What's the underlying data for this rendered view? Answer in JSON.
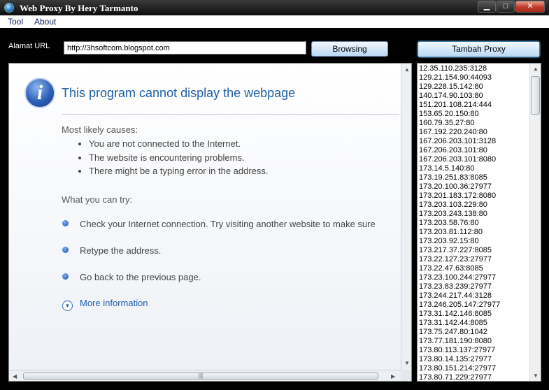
{
  "window": {
    "title": "Web Proxy By Hery Tarmanto",
    "min_glyph": "▁",
    "max_glyph": "□",
    "close_glyph": "✕"
  },
  "menu": {
    "items": [
      "Tool",
      "About"
    ]
  },
  "url_bar": {
    "label": "Alamat URL",
    "value": "http://3hsoftcom.blogspot.com"
  },
  "buttons": {
    "browse": "Browsing",
    "add_proxy": "Tambah Proxy"
  },
  "error_page": {
    "icon_glyph": "i",
    "title": "This program cannot display the webpage",
    "causes_heading": "Most likely causes:",
    "causes": [
      "You are not connected to the Internet.",
      "The website is encountering problems.",
      "There might be a typing error in the address."
    ],
    "try_heading": "What you can try:",
    "try_items": [
      "Check your Internet connection. Try visiting another website to make sure",
      "Retype the address.",
      "Go back to the previous page."
    ],
    "more_info": "More information",
    "more_glyph": "▾"
  },
  "proxies": [
    "12.35.110.235:3128",
    "129.21.154.90:44093",
    "129.228.15.142:80",
    "140.174.90.103:80",
    "151.201.108.214:444",
    "153.65.20.150:80",
    "160.79.35.27:80",
    "167.192.220.240:80",
    "167.206.203.101:3128",
    "167.206.203.101:80",
    "167.206.203.101:8080",
    "173.14.5.140:80",
    "173.19.251.83:8085",
    "173.20.100.36:27977",
    "173.201.183.172:8080",
    "173.203.103.229:80",
    "173.203.243.138:80",
    "173.203.58.76:80",
    "173.203.81.112:80",
    "173.203.92.15:80",
    "173.217.37.227:8085",
    "173.22.127.23:27977",
    "173.22.47.63:8085",
    "173.23.100.244:27977",
    "173.23.83.239:27977",
    "173.244.217.44:3128",
    "173.246.205.147:27977",
    "173.31.142.146:8085",
    "173.31.142.44:8085",
    "173.75.247.80:1042",
    "173.77.181.190:8080",
    "173.80.113.137:27977",
    "173.80.14.135:27977",
    "173.80.151.214:27977",
    "173.80.71.229:27977"
  ]
}
